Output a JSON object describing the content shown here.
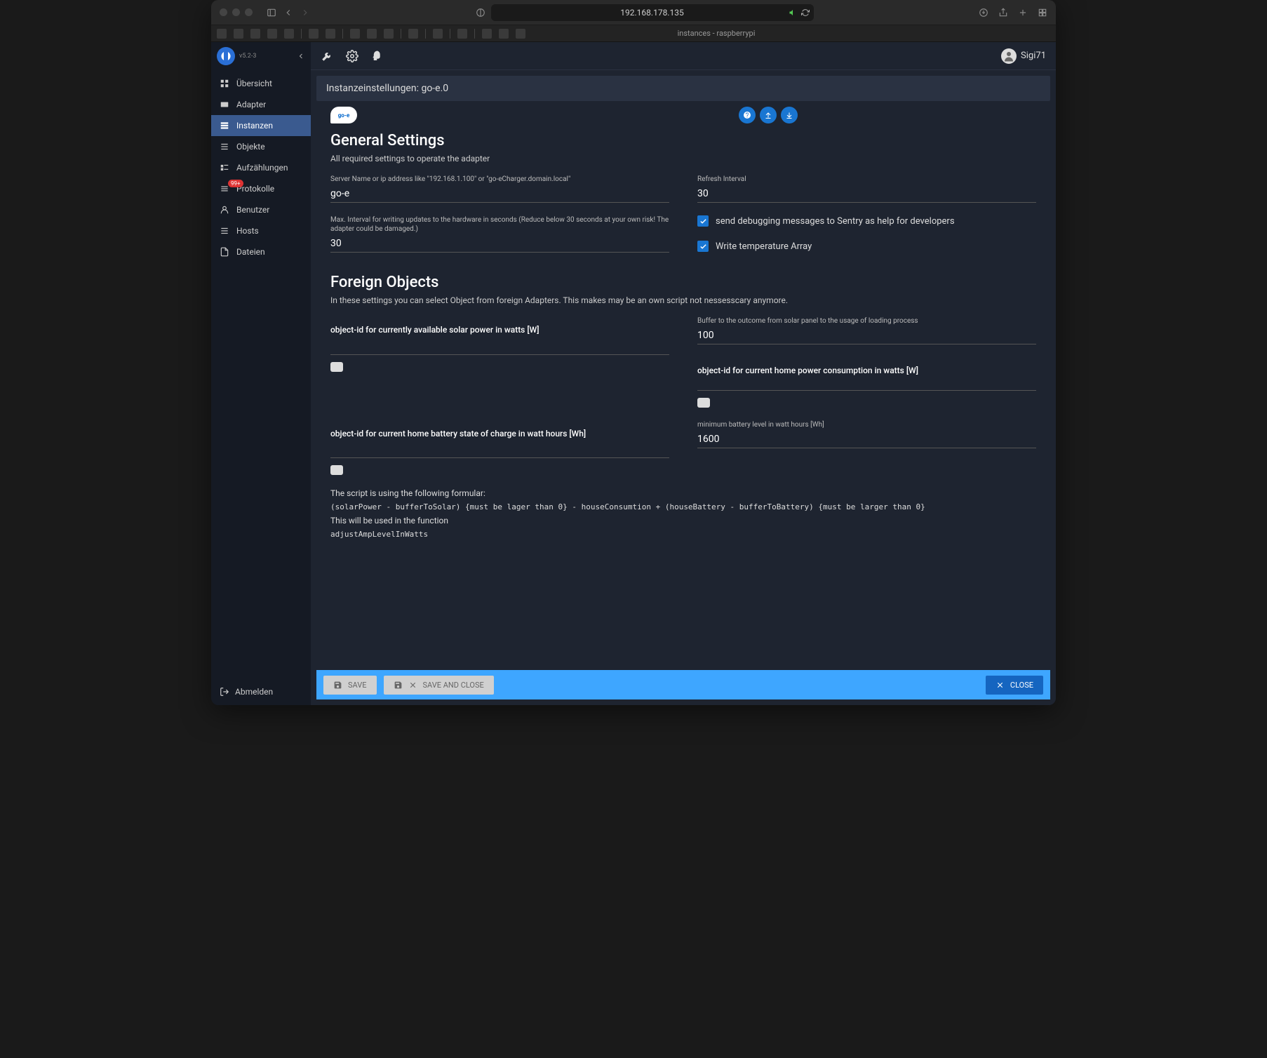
{
  "browser": {
    "url": "192.168.178.135",
    "tab_title": "instances - raspberrypi"
  },
  "app": {
    "version": "v5.2-3",
    "user": "Sigi71"
  },
  "sidebar": {
    "items": [
      {
        "label": "Übersicht"
      },
      {
        "label": "Adapter"
      },
      {
        "label": "Instanzen"
      },
      {
        "label": "Objekte"
      },
      {
        "label": "Aufzählungen"
      },
      {
        "label": "Protokolle",
        "badge": "99+"
      },
      {
        "label": "Benutzer"
      },
      {
        "label": "Hosts"
      },
      {
        "label": "Dateien"
      }
    ],
    "logout": "Abmelden"
  },
  "page": {
    "breadcrumb": "Instanzeinstellungen: go-e.0",
    "adapter_logo_text": "go-e"
  },
  "general": {
    "heading": "General Settings",
    "sub": "All required settings to operate the adapter",
    "server_label": "Server Name or ip address like \"192.168.1.100\" or \"go-eCharger.domain.local\"",
    "server_value": "go-e",
    "refresh_label": "Refresh Interval",
    "refresh_value": "30",
    "maxint_label": "Max. Interval for writing updates to the hardware in seconds (Reduce below 30 seconds at your own risk! The adapter could be damaged.)",
    "maxint_value": "30",
    "sentry_label": "send debugging messages to Sentry as help for developers",
    "temp_label": "Write temperature Array"
  },
  "foreign": {
    "heading": "Foreign Objects",
    "sub": "In these settings you can select Object from foreign Adapters. This makes may be an own script not nessesscary anymore.",
    "solar_label": "object-id for currently available solar power in watts [W]",
    "solar_value": "",
    "buffer_label": "Buffer to the outcome from solar panel to the usage of loading process",
    "buffer_value": "100",
    "home_label": "object-id for current home power consumption in watts [W]",
    "battery_label": "object-id for current home battery state of charge in watt hours [Wh]",
    "battery_value": "",
    "minbatt_label": "minimum battery level in watt hours [Wh]",
    "minbatt_value": "1600",
    "formula_intro": "The script is using the following formular:",
    "formula": "(solarPower - bufferToSolar) {must be lager than 0} - houseConsumtion + (houseBattery - bufferToBattery) {must be larger than 0}",
    "formula_use": "This will be used in the function",
    "formula_fn": "adjustAmpLevelInWatts"
  },
  "footer": {
    "save": "SAVE",
    "save_close": "SAVE AND CLOSE",
    "close": "CLOSE"
  }
}
